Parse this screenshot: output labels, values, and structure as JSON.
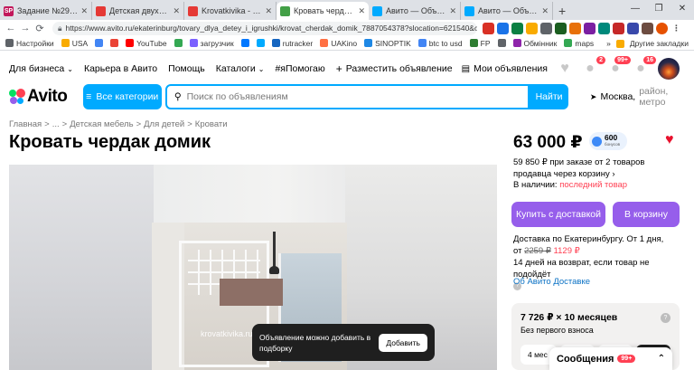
{
  "browser": {
    "tabs": [
      {
        "label": "Задание №2986470 - п",
        "fav_text": "SP",
        "fav_color": "#c2185b",
        "active": false
      },
      {
        "label": "Детская двухъярусная",
        "fav_text": "",
        "fav_color": "#e53935",
        "active": false
      },
      {
        "label": "Krovatkivika - официал",
        "fav_text": "",
        "fav_color": "#e53935",
        "active": false
      },
      {
        "label": "Кровать чердак домик",
        "fav_text": "",
        "fav_color": "#43a047",
        "active": true
      },
      {
        "label": "Авито — Объявления н",
        "fav_text": "",
        "fav_color": "#00aaff",
        "active": false
      },
      {
        "label": "Авито — Объявления н",
        "fav_text": "",
        "fav_color": "#00aaff",
        "active": false
      }
    ],
    "new_tab": "+",
    "url": "https://www.avito.ru/ekaterinburg/tovary_dlya_detey_i_igrushki/krovat_cherdak_domik_7887054378?slocation=621540&conte...",
    "bookmarks": [
      {
        "label": "Настройки",
        "color": "#5f6368"
      },
      {
        "label": "USA",
        "color": "#f9ab00"
      },
      {
        "label": "",
        "color": "#4285f4"
      },
      {
        "label": "",
        "color": "#ea4335"
      },
      {
        "label": "YouTube",
        "color": "#ff0000"
      },
      {
        "label": "",
        "color": "#34a853"
      },
      {
        "label": "загрузчик",
        "color": "#7b61ff"
      },
      {
        "label": "",
        "color": "#0077ff"
      },
      {
        "label": "",
        "color": "#00aaff"
      },
      {
        "label": "rutracker",
        "color": "#1565c0"
      },
      {
        "label": "UAKino",
        "color": "#ff7043"
      },
      {
        "label": "SINOPTIK",
        "color": "#1e88e5"
      },
      {
        "label": "btc to usd",
        "color": "#4285f4"
      },
      {
        "label": "FP",
        "color": "#2e7d32"
      },
      {
        "label": "",
        "color": "#5f6368"
      },
      {
        "label": "Обмінник",
        "color": "#8e24aa"
      },
      {
        "label": "maps",
        "color": "#34a853"
      }
    ],
    "bookmarks_right": "Другие закладки"
  },
  "topnav": {
    "items": [
      "Для бизнеса",
      "Карьера в Авито",
      "Помощь",
      "Каталоги",
      "#яПомогаю"
    ],
    "post_ad": "Разместить объявление",
    "my_ads": "Мои объявления",
    "badges": {
      "notifications": "2",
      "messages": "99+",
      "cart": "16"
    }
  },
  "search": {
    "logo": "Avito",
    "categories_button": "Все категории",
    "placeholder": "Поиск по объявлениям",
    "find_button": "Найти",
    "city": "Москва,",
    "location_rest": "район, метро"
  },
  "breadcrumb": [
    "Главная",
    ">",
    "...",
    ">",
    "Детская мебель",
    ">",
    "Для детей",
    ">",
    "Кровати"
  ],
  "listing": {
    "title": "Кровать чердак домик",
    "watermark": "krovatkivika.ru",
    "price": "63 000 ₽",
    "bonus_value": "600",
    "bonus_caption": "бонусов",
    "promo": "59 850 ₽ при заказе от 2 товаров продавца через корзину ›",
    "stock_label": "В наличии:",
    "stock_value": "последний товар",
    "buy_button": "Купить с доставкой",
    "cart_button": "В корзину",
    "delivery_line1": "Доставка по Екатеринбургу. От 1 дня,",
    "delivery_from": "от",
    "delivery_old": "2259 ₽",
    "delivery_new": "1129 ₽",
    "return_policy": "14 дней на возврат, если товар не подойдёт",
    "about_delivery": "Об Авито Доставке"
  },
  "toast": {
    "text": "Объявление можно добавить в подборку",
    "button": "Добавить"
  },
  "installment": {
    "title": "7 726 ₽ × 10 месяцев",
    "subtitle": "Без первого взноса",
    "chips": [
      "4 мес"
    ]
  },
  "messages": {
    "label": "Сообщения",
    "badge": "99+"
  },
  "colors": {
    "brand_blue": "#00aaff",
    "purple": "#965eeb",
    "red": "#ff4053",
    "link": "#0a71c4"
  }
}
